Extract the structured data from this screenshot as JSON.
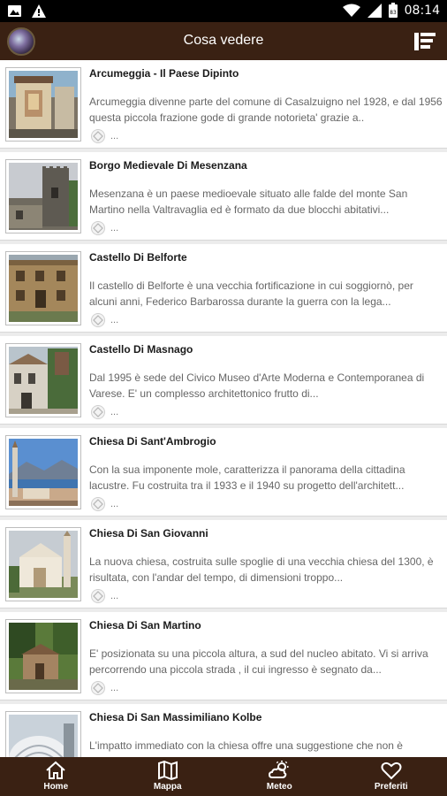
{
  "status_bar": {
    "time": "08:14",
    "battery": "83"
  },
  "app_bar": {
    "title": "Cosa vedere"
  },
  "items": [
    {
      "title": "Arcumeggia - Il Paese Dipinto",
      "description": "Arcumeggia divenne parte del comune di Casalzuigno nel 1928, e dal 1956 questa piccola frazione gode di grande notorieta' grazie a..",
      "more": "...",
      "image": "painted-chapel"
    },
    {
      "title": "Borgo Medievale Di Mesenzana",
      "description": "Mesenzana è un paese medioevale situato alle falde del monte San Martino nella Valtravaglia ed è formato da due blocchi abitativi...",
      "more": "...",
      "image": "medieval-tower"
    },
    {
      "title": "Castello Di Belforte",
      "description": "Il castello di Belforte è una vecchia fortificazione in cui soggiornò, per alcuni anni, Federico Barbarossa durante la guerra con la lega...",
      "more": "...",
      "image": "castle-facade"
    },
    {
      "title": "Castello Di Masnago",
      "description": "Dal 1995 è sede del Civico Museo d'Arte Moderna e Contemporanea di Varese. E' un complesso architettonico frutto di...",
      "more": "...",
      "image": "masnago-castle"
    },
    {
      "title": "Chiesa Di Sant'Ambrogio",
      "description": "Con la sua imponente mole, caratterizza il panorama della cittadina lacustre. Fu costruita tra il 1933 e il 1940 su progetto dell'architett...",
      "more": "...",
      "image": "lake-church"
    },
    {
      "title": "Chiesa Di San Giovanni",
      "description": "La nuova chiesa, costruita sulle spoglie di una vecchia chiesa del 1300, è risultata, con l'andar del tempo, di dimensioni troppo...",
      "more": "...",
      "image": "white-church"
    },
    {
      "title": "Chiesa Di San Martino",
      "description": "E' posizionata su una piccola altura, a sud del nucleo abitato. Vi si arriva percorrendo una piccola strada , il cui ingresso è segnato da...",
      "more": "...",
      "image": "stone-church"
    },
    {
      "title": "Chiesa Di San Massimiliano Kolbe",
      "description": "L'impatto immediato con la chiesa offre una suggestione che non è",
      "more": "...",
      "image": "modern-church"
    }
  ],
  "bottom_nav": [
    {
      "label": "Home",
      "icon": "home-icon"
    },
    {
      "label": "Mappa",
      "icon": "map-icon"
    },
    {
      "label": "Meteo",
      "icon": "weather-icon"
    },
    {
      "label": "Preferiti",
      "icon": "heart-icon"
    }
  ],
  "colors": {
    "bar": "#3a2113",
    "status": "#000000",
    "card": "#ffffff",
    "background": "#ececec"
  }
}
